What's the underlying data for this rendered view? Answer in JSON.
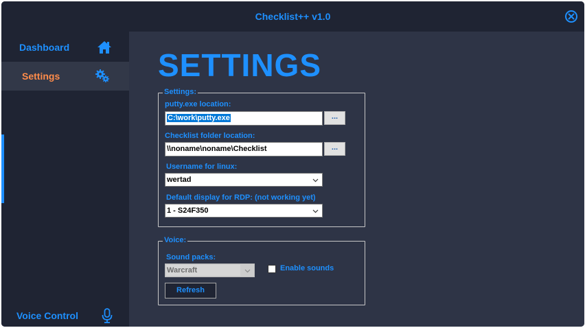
{
  "window": {
    "title": "Checklist++ v1.0"
  },
  "sidebar": {
    "items": [
      {
        "label": "Dashboard",
        "icon": "home-icon"
      },
      {
        "label": "Settings",
        "icon": "gears-icon",
        "active": true
      },
      {
        "label": "Voice Control",
        "icon": "microphone-icon"
      }
    ]
  },
  "main": {
    "title": "SETTINGS",
    "settings_group": {
      "legend": "Settings:",
      "putty_label": "putty.exe location:",
      "putty_value": "C:\\work\\putty.exe",
      "putty_browse": "...",
      "folder_label": "Checklist folder location:",
      "folder_value": "\\\\noname\\noname\\Checklist",
      "folder_browse": "...",
      "username_label": "Username for linux:",
      "username_value": "wertad",
      "rdp_label": "Default display for RDP: (not working yet)",
      "rdp_value": "1 - S24F350"
    },
    "voice_group": {
      "legend": "Voice:",
      "soundpacks_label": "Sound packs:",
      "soundpacks_value": "Warcraft",
      "enable_sounds_label": "Enable sounds",
      "enable_sounds_checked": false,
      "refresh_label": "Refresh"
    }
  },
  "colors": {
    "accent": "#1e90ff",
    "active_nav": "#ff8c4a",
    "background": "#1f2433",
    "content_background": "#2e3446"
  }
}
